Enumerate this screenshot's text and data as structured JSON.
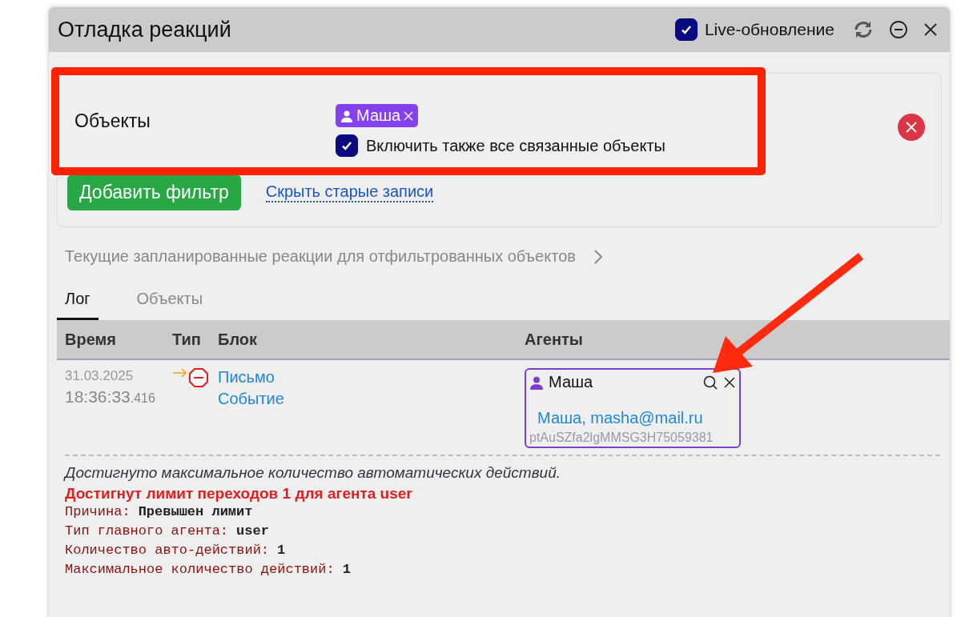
{
  "window": {
    "title": "Отладка реакций",
    "live_update": {
      "label": "Live-обновление",
      "checked": true
    }
  },
  "filters": {
    "rows": [
      {
        "label": "Объекты",
        "chips": [
          {
            "label": "Маша"
          }
        ],
        "include_related": {
          "label": "Включить также все связанные объекты",
          "checked": true
        }
      }
    ],
    "add_button": "Добавить фильтр",
    "hide_link": "Скрыть старые записи"
  },
  "scheduled": {
    "label": "Текущие запланированные реакции для отфильтрованных объектов"
  },
  "tabs": [
    {
      "label": "Лог",
      "selected": true
    },
    {
      "label": "Объекты",
      "selected": false
    }
  ],
  "table": {
    "columns": [
      "Время",
      "Тип",
      "Блок",
      "Агенты"
    ],
    "rows": [
      {
        "date": "31.03.2025",
        "time": "18:36:33",
        "millis": ".416",
        "blocks": [
          "Письмо",
          "Событие"
        ],
        "agent": {
          "name": "Маша",
          "link": "Маша, masha@mail.ru",
          "id": "ptAuSZfa2lgMMSG3H75059381"
        },
        "message": {
          "note": "Достигнуто максимальное количество автоматических действий.",
          "error": "Достигнут лимит переходов 1 для агента user",
          "details": [
            {
              "label": "Причина:",
              "value": "Превышен лимит"
            },
            {
              "label": "Тип главного агента:",
              "value": "user"
            },
            {
              "label": "Количество авто-действий:",
              "value": "1"
            },
            {
              "label": "Максимальное количество действий:",
              "value": "1"
            }
          ]
        }
      }
    ]
  }
}
